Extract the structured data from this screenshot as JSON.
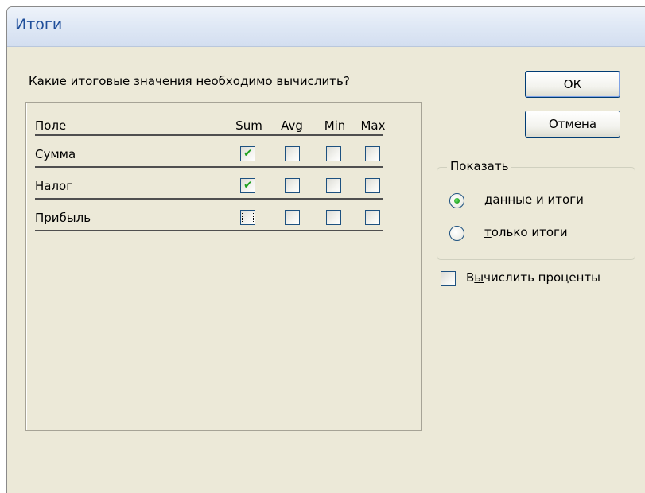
{
  "window": {
    "title": "Итоги"
  },
  "prompt": "Какие итоговые значения необходимо вычислить?",
  "grid": {
    "field_header": "Поле",
    "columns": [
      "Sum",
      "Avg",
      "Min",
      "Max"
    ],
    "rows": [
      {
        "label": "Сумма",
        "checked": [
          true,
          false,
          false,
          false
        ]
      },
      {
        "label": "Налог",
        "checked": [
          true,
          false,
          false,
          false
        ]
      },
      {
        "label": "Прибыль",
        "checked": [
          false,
          false,
          false,
          false
        ]
      }
    ]
  },
  "buttons": {
    "ok": "ОК",
    "cancel": "Отмена"
  },
  "show_group": {
    "legend": "Показать",
    "options": [
      {
        "label_underlined": "д",
        "label_rest": "анные и итоги",
        "selected": true
      },
      {
        "label_underlined": "т",
        "label_rest": "олько итоги",
        "selected": false
      }
    ]
  },
  "percent": {
    "label_pre": "В",
    "label_underlined": "ы",
    "label_rest": "числить проценты",
    "checked": false
  },
  "colors": {
    "check": "#21a121",
    "title_text": "#1f4e9a",
    "dialog_bg": "#ece9d8"
  }
}
